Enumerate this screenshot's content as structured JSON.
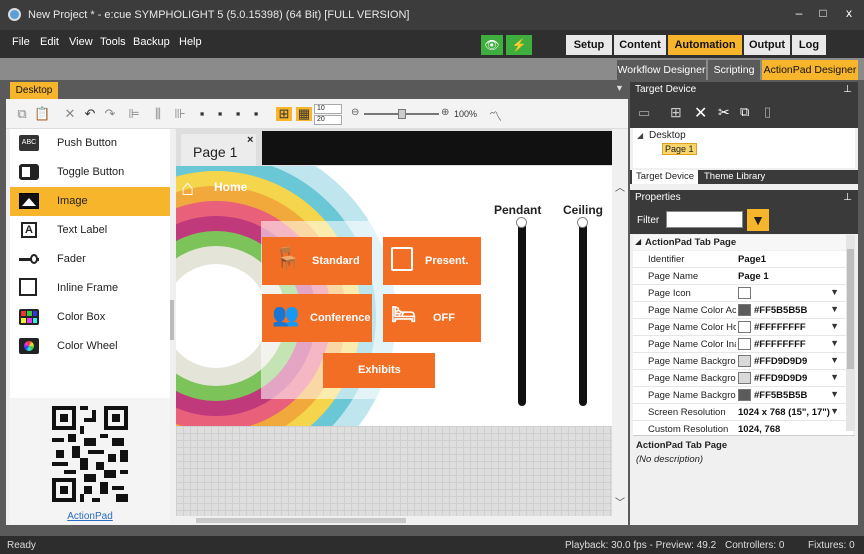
{
  "window": {
    "title": "New Project * - e:cue SYMPHOLIGHT 5 (5.0.15398) (64 Bit) [FULL VERSION]",
    "minimize": "–",
    "maximize": "□",
    "close": "x"
  },
  "menu": [
    "File",
    "Edit",
    "View",
    "Tools",
    "Backup",
    "Help"
  ],
  "top_tabs": {
    "setup": "Setup",
    "content": "Content",
    "automation": "Automation",
    "output": "Output",
    "log": "Log"
  },
  "sub_tabs": {
    "workflow": "Workflow Designer",
    "scripting": "Scripting",
    "actionpad": "ActionPad Designer"
  },
  "desktop_tab": "Desktop",
  "toolbar": {
    "spin1": "10",
    "spin2": "20",
    "zoom": "100%"
  },
  "palette": [
    {
      "label": "Push Button",
      "icon": "abc-button-icon"
    },
    {
      "label": "Toggle Button",
      "icon": "toggle-icon"
    },
    {
      "label": "Image",
      "icon": "image-icon"
    },
    {
      "label": "Text Label",
      "icon": "text-label-icon"
    },
    {
      "label": "Fader",
      "icon": "fader-icon"
    },
    {
      "label": "Inline Frame",
      "icon": "inline-frame-icon"
    },
    {
      "label": "Color Box",
      "icon": "color-box-icon"
    },
    {
      "label": "Color Wheel",
      "icon": "color-wheel-icon"
    }
  ],
  "qr_link": "ActionPad",
  "page": {
    "tab": "Page 1",
    "close": "×",
    "home": "Home",
    "pendant": "Pendant",
    "ceiling": "Ceiling",
    "buttons": {
      "standard": "Standard",
      "present": "Present.",
      "conference": "Conference",
      "off": "OFF",
      "exhibits": "Exhibits"
    }
  },
  "target": {
    "title": "Target Device",
    "pin": "ᵖ",
    "tree_root": "Desktop",
    "tree_child": "Page 1",
    "tab1": "Target Device",
    "tab2": "Theme Library"
  },
  "properties": {
    "title": "Properties",
    "filter_label": "Filter",
    "section": "ActionPad Tab Page",
    "rows": [
      {
        "k": "Identifier",
        "v": "Page1"
      },
      {
        "k": "Page Name",
        "v": "Page 1"
      },
      {
        "k": "Page Icon",
        "v": "",
        "sw": "#FFFFFF",
        "dd": true
      },
      {
        "k": "Page Name Color Act",
        "v": "#FF5B5B5B",
        "sw": "#5B5B5B",
        "dd": true
      },
      {
        "k": "Page Name Color Ho",
        "v": "#FFFFFFFF",
        "sw": "#FFFFFF",
        "dd": true
      },
      {
        "k": "Page Name Color Ina",
        "v": "#FFFFFFFF",
        "sw": "#FFFFFF",
        "dd": true
      },
      {
        "k": "Page Name Backgrou",
        "v": "#FFD9D9D9",
        "sw": "#D9D9D9",
        "dd": true
      },
      {
        "k": "Page Name Backgrou",
        "v": "#FFD9D9D9",
        "sw": "#D9D9D9",
        "dd": true
      },
      {
        "k": "Page Name Backgrou",
        "v": "#FF5B5B5B",
        "sw": "#5B5B5B",
        "dd": true
      },
      {
        "k": "Screen Resolution",
        "v": "1024 x 768 (15\", 17\")",
        "dd": true
      },
      {
        "k": "Custom Resolution",
        "v": "1024, 768"
      }
    ],
    "desc_title": "ActionPad Tab Page",
    "desc": "(No description)"
  },
  "status": {
    "ready": "Ready",
    "playback": "Playback: 30.0 fps - Preview: 49.2",
    "controllers": "Controllers: 0",
    "fixtures": "Fixtures: 0"
  },
  "colors": {
    "accent": "#F7B52C",
    "orange": "#F26E24"
  }
}
